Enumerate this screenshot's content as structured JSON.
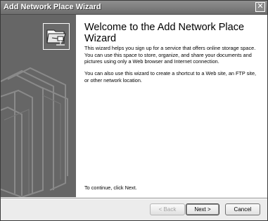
{
  "window": {
    "title": "Add Network Place Wizard",
    "close_glyph": "✕"
  },
  "content": {
    "heading": "Welcome to the Add Network Place Wizard",
    "paragraph1": "This wizard helps you sign up for a service that offers online storage space. You can use this space to store, organize, and share your documents and pictures using only a Web browser and Internet connection.",
    "paragraph2": "You can also use this wizard to create a shortcut to a Web site, an FTP site, or other network location.",
    "continue_text": "To continue, click Next."
  },
  "buttons": {
    "back": "< Back",
    "next": "Next >",
    "cancel": "Cancel"
  },
  "icons": {
    "wizard": "network-folder-icon",
    "watermark": "folder-watermark-graphic",
    "close": "close-icon"
  }
}
